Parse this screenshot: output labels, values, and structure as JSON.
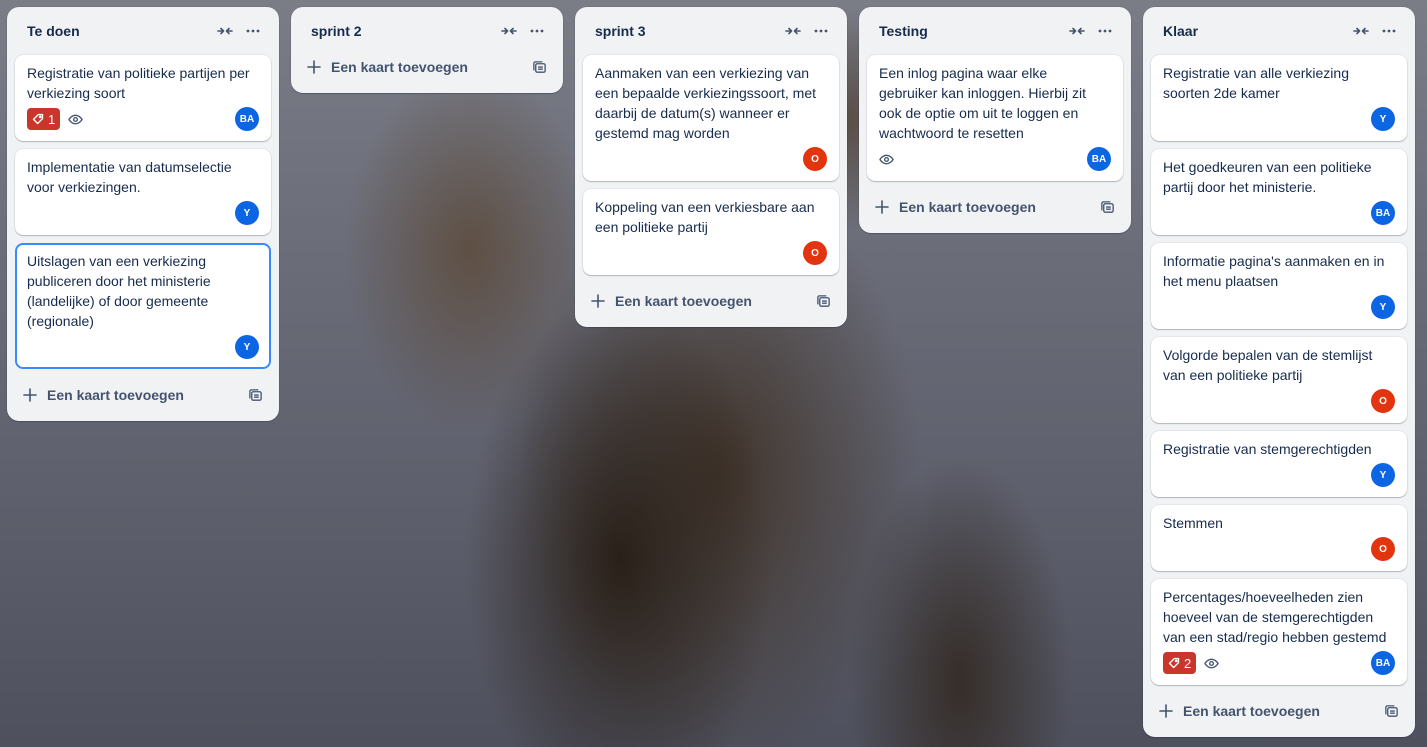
{
  "add_card_label": "Een kaart toevoegen",
  "colors": {
    "avatar_BA": "#0c66e4",
    "avatar_Y": "#0c66e4",
    "avatar_O": "#e2340f",
    "label_red": "#c9372c",
    "focus_border": "#388bff"
  },
  "lists": [
    {
      "title": "Te doen",
      "cards": [
        {
          "title": "Registratie van politieke partijen per verkiezing soort",
          "badge_count": "1",
          "watching": true,
          "avatar": "BA"
        },
        {
          "title": "Implementatie van datumselectie voor verkiezingen.",
          "avatar": "Y"
        },
        {
          "title": "Uitslagen van een verkiezing publiceren door het ministerie (landelijke) of door gemeente (regionale)",
          "avatar": "Y",
          "focused": true
        }
      ]
    },
    {
      "title": "sprint 2",
      "cards": []
    },
    {
      "title": "sprint 3",
      "cards": [
        {
          "title": "Aanmaken van een verkiezing van een bepaalde verkiezingssoort, met daarbij de datum(s) wanneer er gestemd mag worden",
          "avatar": "O"
        },
        {
          "title": "Koppeling van een verkiesbare aan een politieke partij",
          "avatar": "O"
        }
      ]
    },
    {
      "title": "Testing",
      "cards": [
        {
          "title": "Een inlog pagina waar elke gebruiker kan inloggen. Hierbij zit ook de optie om uit te loggen en wachtwoord te resetten",
          "watching": true,
          "avatar": "BA"
        }
      ]
    },
    {
      "title": "Klaar",
      "cards": [
        {
          "title": "Registratie van alle verkiezing soorten 2de kamer",
          "avatar": "Y"
        },
        {
          "title": "Het goedkeuren van een politieke partij door het ministerie.",
          "avatar": "BA"
        },
        {
          "title": "Informatie pagina's aanmaken en in het menu plaatsen",
          "avatar": "Y"
        },
        {
          "title": "Volgorde bepalen van de stemlijst van een politieke partij",
          "avatar": "O"
        },
        {
          "title": "Registratie van stemgerechtigden",
          "avatar": "Y"
        },
        {
          "title": "Stemmen",
          "avatar": "O"
        },
        {
          "title": "Percentages/hoeveelheden zien hoeveel van de stemgerechtigden van een stad/regio hebben gestemd",
          "badge_count": "2",
          "watching": true,
          "avatar": "BA"
        }
      ]
    }
  ]
}
